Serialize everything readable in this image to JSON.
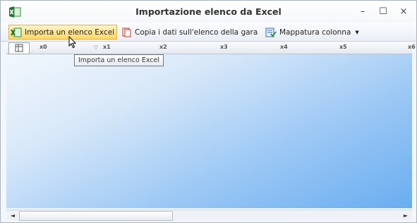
{
  "window": {
    "title": "Importazione elenco da Excel",
    "controls": {
      "minimize": "–",
      "maximize": "☐",
      "close": "×"
    }
  },
  "toolbar": {
    "import_label": "Importa un elenco Excel",
    "copy_label": "Copia i dati sull'elenco della gara",
    "mapping_label": "Mappatura colonna",
    "mapping_arrow": "▼"
  },
  "grid": {
    "columns": [
      "x0",
      "x1",
      "x2",
      "x3",
      "x4",
      "x5",
      "x6"
    ],
    "filter_icon_glyph": "▽"
  },
  "tooltip": {
    "text": "Importa un elenco Excel"
  },
  "scrollbar": {
    "left_arrow": "◄",
    "right_arrow": "►"
  },
  "icons": {
    "app": "excel-icon",
    "import": "excel-import-icon",
    "copy": "copy-icon",
    "mapping": "column-mapping-icon"
  },
  "colors": {
    "accent_hover": "#ffd966",
    "excel_green": "#2e8b3a",
    "grid_blue": "#6aadf0"
  }
}
